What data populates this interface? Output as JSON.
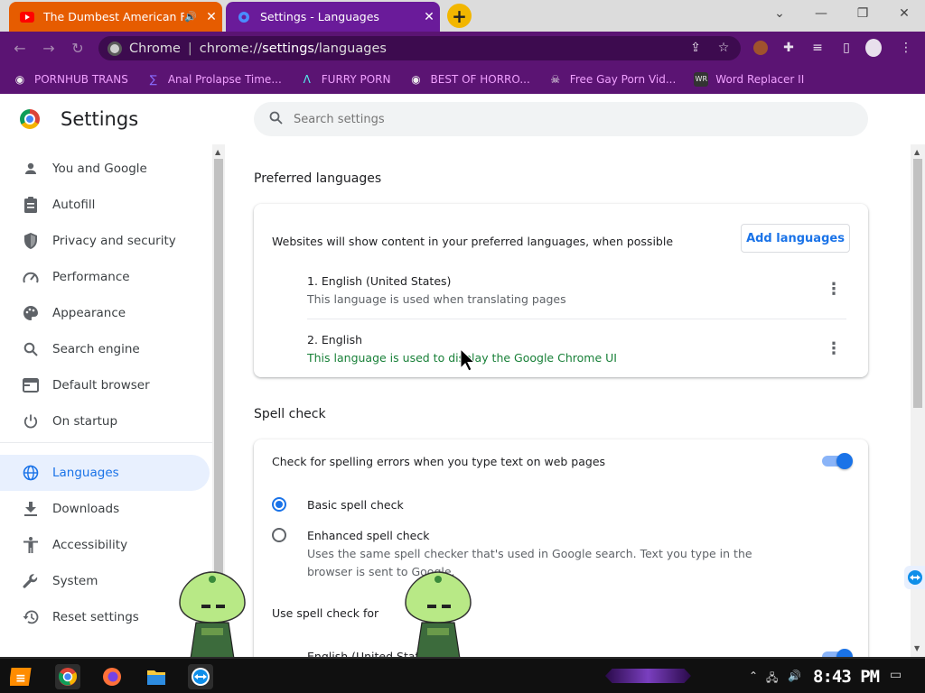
{
  "tabs": [
    {
      "title": "The Dumbest American Fa",
      "icon": "youtube-icon",
      "audio": true
    },
    {
      "title": "Settings - Languages",
      "icon": "settings-gear-icon"
    }
  ],
  "omnibox": {
    "site_label": "Chrome",
    "url_prefix": "chrome://",
    "url_strong": "settings",
    "url_suffix": "/languages"
  },
  "bookmarks": [
    {
      "label": "PORNHUB TRANS",
      "icon": "globe-icon"
    },
    {
      "label": "Anal Prolapse Time...",
      "icon": "bookmark-icon"
    },
    {
      "label": "FURRY PORN",
      "icon": "lambda-icon"
    },
    {
      "label": "BEST OF HORRO...",
      "icon": "globe-icon"
    },
    {
      "label": "Free Gay Porn Vid...",
      "icon": "skull-icon"
    },
    {
      "label": "Word Replacer II",
      "icon": "wr-icon"
    }
  ],
  "settings": {
    "title": "Settings",
    "search_placeholder": "Search settings"
  },
  "nav": [
    {
      "label": "You and Google",
      "icon": "person-icon"
    },
    {
      "label": "Autofill",
      "icon": "clipboard-icon"
    },
    {
      "label": "Privacy and security",
      "icon": "shield-icon"
    },
    {
      "label": "Performance",
      "icon": "speedometer-icon"
    },
    {
      "label": "Appearance",
      "icon": "palette-icon"
    },
    {
      "label": "Search engine",
      "icon": "search-icon"
    },
    {
      "label": "Default browser",
      "icon": "browser-icon"
    },
    {
      "label": "On startup",
      "icon": "power-icon"
    },
    {
      "label": "Languages",
      "icon": "globe-icon",
      "active": true
    },
    {
      "label": "Downloads",
      "icon": "download-icon"
    },
    {
      "label": "Accessibility",
      "icon": "accessibility-icon"
    },
    {
      "label": "System",
      "icon": "wrench-icon"
    },
    {
      "label": "Reset settings",
      "icon": "history-icon"
    }
  ],
  "preferred": {
    "section_title": "Preferred languages",
    "description": "Websites will show content in your preferred languages, when possible",
    "add_button": "Add languages",
    "languages": [
      {
        "name": "1. English (United States)",
        "note": "This language is used when translating pages"
      },
      {
        "name": "2. English",
        "note": "This language is used to display the Google Chrome UI"
      }
    ]
  },
  "spell": {
    "section_title": "Spell check",
    "toggle_label": "Check for spelling errors when you type text on web pages",
    "toggle_on": true,
    "basic_label": "Basic spell check",
    "enhanced_label": "Enhanced spell check",
    "enhanced_desc_1": "Uses the same spell checker that's used in Google search. Text you type in the",
    "enhanced_desc_2": "browser is sent to Google.",
    "use_for": "Use spell check for",
    "use_for_lang": "English (United States)"
  },
  "taskbar": {
    "clock": "8:43 PM"
  },
  "colors": {
    "tab_active": "#6a1b9a",
    "tab_inactive": "#e65c00",
    "toolbar": "#5b1473",
    "accent": "#1a73e8"
  }
}
